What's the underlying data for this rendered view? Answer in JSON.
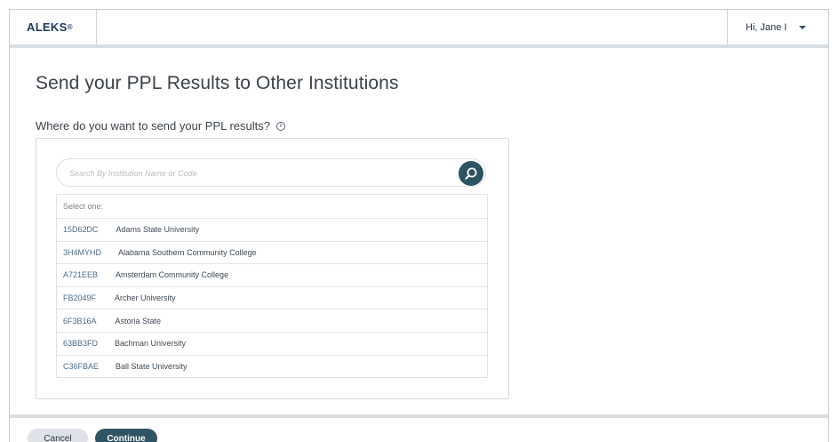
{
  "header": {
    "logo": "ALEKS",
    "logo_mark": "®",
    "user_greeting": "Hi, Jane I"
  },
  "page": {
    "title": "Send your PPL Results  to Other Institutions",
    "question": "Where do you want to send your PPL results?",
    "info_glyph": "i"
  },
  "search": {
    "placeholder": "Search By Institution Name or Code",
    "value": ""
  },
  "list": {
    "header": "Select one:",
    "items": [
      {
        "code": "15D62DC",
        "name": "Adams State University"
      },
      {
        "code": "3H4MYHD",
        "name": "Alabama Southern Community College"
      },
      {
        "code": "A721EEB",
        "name": "Amsterdam Community College"
      },
      {
        "code": "FB2049F",
        "name": "Archer University"
      },
      {
        "code": "6F3B16A",
        "name": "Astoria State"
      },
      {
        "code": "63BB3FD",
        "name": "Bachman University"
      },
      {
        "code": "C36FBAE",
        "name": "Ball State University"
      }
    ]
  },
  "footer": {
    "cancel_label": "Cancel",
    "continue_label": "Continue"
  },
  "colors": {
    "primary": "#2f5465",
    "secondary_button": "#dfe3e7",
    "logo": "#1c3a5e"
  },
  "icons": {
    "search": "magnifier-icon",
    "info": "info-circle-icon",
    "user_menu": "chevron-down-icon"
  }
}
